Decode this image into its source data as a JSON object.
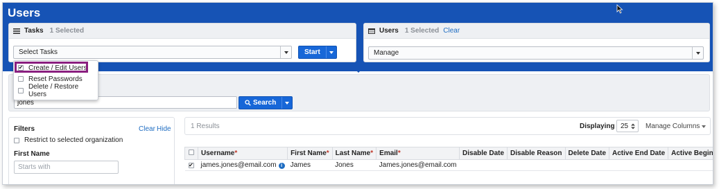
{
  "page": {
    "title": "Users"
  },
  "tasks_panel": {
    "title": "Tasks",
    "selected": "1 Selected",
    "select_value": "Select Tasks",
    "start_label": "Start",
    "menu": [
      {
        "label": "Create / Edit Users",
        "checked": true
      },
      {
        "label": "Reset Passwords",
        "checked": false
      },
      {
        "label": "Delete / Restore Users",
        "checked": false
      }
    ]
  },
  "users_panel": {
    "title": "Users",
    "selected": "1 Selected",
    "clear_label": "Clear",
    "select_value": "Manage"
  },
  "search": {
    "value": "jones",
    "button_label": "Search"
  },
  "filters": {
    "title": "Filters",
    "clear_label": "Clear",
    "hide_label": "Hide",
    "restrict_label": "Restrict to selected organization",
    "first_name_label": "First Name",
    "first_name_placeholder": "Starts with"
  },
  "results": {
    "count_text": "1 Results",
    "displaying_label": "Displaying",
    "page_size": "25",
    "manage_columns_label": "Manage Columns"
  },
  "table": {
    "columns": [
      {
        "label": "Username",
        "required": "*"
      },
      {
        "label": "First Name",
        "required": "*"
      },
      {
        "label": "Last Name",
        "required": "*"
      },
      {
        "label": "Email",
        "required": "*"
      },
      {
        "label": "Disable Date",
        "required": ""
      },
      {
        "label": "Disable Reason",
        "required": ""
      },
      {
        "label": "Delete Date",
        "required": ""
      },
      {
        "label": "Active End Date",
        "required": ""
      },
      {
        "label": "Active Begin Date",
        "required": ""
      }
    ],
    "rows": [
      {
        "checked": true,
        "username": "james.jones@email.com",
        "first_name": "James",
        "last_name": "Jones",
        "email": "James.jones@email.com",
        "disable_date": "",
        "disable_reason": "",
        "delete_date": "",
        "active_end_date": "",
        "active_begin_date": ""
      }
    ]
  },
  "colors": {
    "brand_blue": "#1653b5",
    "button_blue": "#1767d8",
    "highlight": "#8a1f7f",
    "link": "#1f6dc2"
  }
}
